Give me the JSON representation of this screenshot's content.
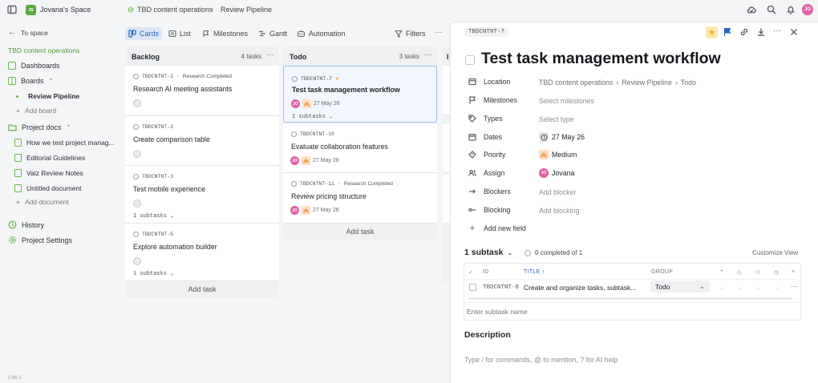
{
  "topbar": {
    "workspace_badge": "JS",
    "workspace_name": "Jovana's Space",
    "breadcrumb": [
      "TBD content operations",
      "Review Pipeline"
    ],
    "user_initials": "JO"
  },
  "sidebar": {
    "back_label": "To space",
    "project_name": "TBD content operations",
    "items": {
      "dashboards": "Dashboards",
      "boards": "Boards",
      "board_review": "Review Pipeline",
      "add_board": "Add board",
      "project_docs": "Project docs",
      "doc1": "How we test project manag...",
      "doc2": "Editorial Guidelines",
      "doc3": "Vaiz Review Notes",
      "doc4": "Untitled document",
      "add_document": "Add document",
      "history": "History",
      "settings": "Project Settings"
    },
    "version": "2.86.1"
  },
  "views": {
    "cards": "Cards",
    "list": "List",
    "milestones": "Milestones",
    "gantt": "Gantt",
    "automation": "Automation",
    "filters": "Filters"
  },
  "columns": {
    "backlog": {
      "title": "Backlog",
      "count": "4 tasks",
      "cards": [
        {
          "id": "TBDCNTNT-1",
          "tag": "Research Completed",
          "title": "Research AI meeting assistants"
        },
        {
          "id": "TBDCNTNT-2",
          "title": "Create comparison table"
        },
        {
          "id": "TBDCNTNT-3",
          "title": "Test mobile experience",
          "subtasks": "1 subtasks"
        },
        {
          "id": "TBDCNTNT-5",
          "title": "Explore automation builder",
          "subtasks": "1 subtasks"
        }
      ],
      "add_task": "Add task"
    },
    "todo": {
      "title": "Todo",
      "count": "3 tasks",
      "cards": [
        {
          "id": "TBDCNTNT-7",
          "title": "Test task management workflow",
          "date": "27 May 26",
          "subtasks": "1 subtasks"
        },
        {
          "id": "TBDCNTNT-10",
          "title": "Evaluate collaboration features",
          "date": "27 May 26"
        },
        {
          "id": "TBDCNTNT-11",
          "tag": "Research Completed",
          "title": "Review pricing structure",
          "date": "27 May 26"
        }
      ],
      "add_task": "Add task"
    },
    "peek_initial": "I"
  },
  "panel": {
    "task_id": "TBDCNTNT-7",
    "title": "Test task management workflow",
    "properties": {
      "location_label": "Location",
      "location_value": [
        "TBD content operations",
        "Review Pipeline",
        "Todo"
      ],
      "milestones_label": "Milestones",
      "milestones_value": "Select milestones",
      "types_label": "Types",
      "types_value": "Select type",
      "dates_label": "Dates",
      "dates_value": "27 May 26",
      "priority_label": "Priority",
      "priority_value": "Medium",
      "assign_label": "Assign",
      "assign_value": "Jovana",
      "assign_initials": "JO",
      "blockers_label": "Blockers",
      "blockers_value": "Add blocker",
      "blocking_label": "Blocking",
      "blocking_value": "Add blocking",
      "add_field": "Add new field"
    },
    "subtasks": {
      "heading": "1 subtask",
      "completed": "0 completed of 1",
      "customize": "Customize View",
      "columns": {
        "id": "ID",
        "title": "TITLE",
        "group": "GROUP"
      },
      "rows": [
        {
          "id": "TBDCNTNT-8",
          "title": "Create and organize tasks, subtask...",
          "group": "Todo"
        }
      ],
      "empty_cells": [
        "-",
        "-",
        "-",
        "-"
      ],
      "input_placeholder": "Enter subtask name"
    },
    "description": {
      "heading": "Description",
      "placeholder": "Type / for commands, @ to mention, ? for AI help"
    }
  },
  "colors": {
    "accent_green": "#6bb94a",
    "accent_blue": "#2366c2",
    "avatar_pink": "#e35ea6",
    "priority_orange": "#f08a2c",
    "star_gold": "#f2b01e"
  }
}
